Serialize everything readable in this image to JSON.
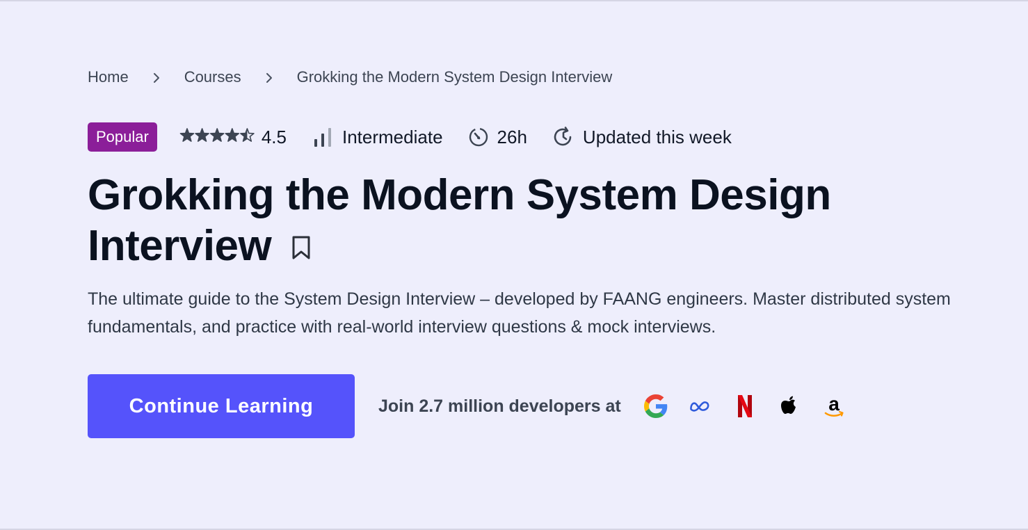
{
  "breadcrumb": {
    "home": "Home",
    "courses": "Courses",
    "current": "Grokking the Modern System Design Interview"
  },
  "meta": {
    "badge": "Popular",
    "rating": "4.5",
    "rating_value": 4.5,
    "rating_max": 5,
    "level": "Intermediate",
    "duration": "26h",
    "updated": "Updated this week"
  },
  "course": {
    "title": "Grokking the Modern System Design Interview",
    "description": "The ultimate guide to the System Design Interview – developed by FAANG engineers. Master distributed system fundamentals, and practice with real-world interview questions & mock interviews."
  },
  "cta": {
    "button_label": "Continue Learning",
    "join_text": "Join 2.7 million developers at"
  },
  "companies": [
    "google-logo",
    "meta-logo",
    "netflix-logo",
    "apple-logo",
    "amazon-logo"
  ],
  "colors": {
    "background": "#eeeefc",
    "badge": "#8b1e99",
    "primary_button": "#5553fb",
    "heading": "#0b1220"
  }
}
